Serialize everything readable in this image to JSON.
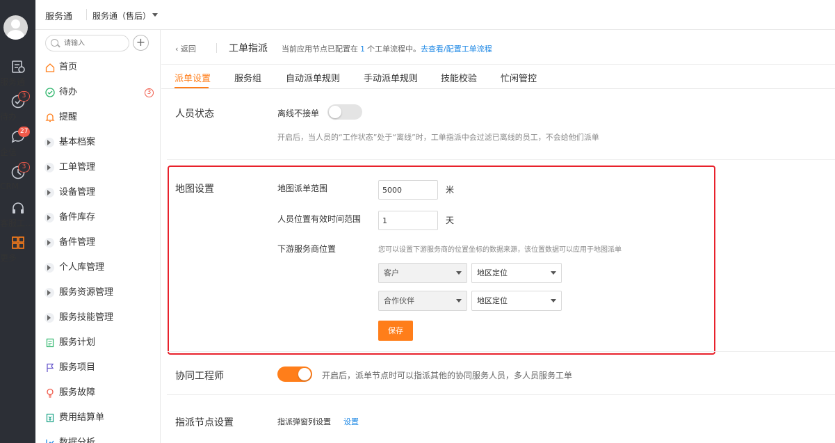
{
  "rail": {
    "items": [
      {
        "label": "服务通",
        "icon": "service-icon",
        "badge": null
      },
      {
        "label": "待办",
        "icon": "todo-check-icon",
        "badge": "3"
      },
      {
        "label": "企信",
        "icon": "chat-bubble-icon",
        "badge": "27"
      },
      {
        "label": "CRM",
        "icon": "crm-clock-icon",
        "badge": "3"
      },
      {
        "label": "客服工…",
        "icon": "headset-icon",
        "badge": null
      },
      {
        "label": "更多",
        "icon": "grid-more-icon",
        "badge": null
      }
    ]
  },
  "topbar": {
    "app_name": "服务通",
    "version_label": "服务通（售后）"
  },
  "sidebar": {
    "search_placeholder": "请输入",
    "add_label": "+",
    "items": [
      {
        "label": "首页",
        "icon": "home-icon"
      },
      {
        "label": "待办",
        "icon": "check-circle-icon",
        "badge": "3"
      },
      {
        "label": "提醒",
        "icon": "bell-icon"
      },
      {
        "label": "基本档案",
        "icon": "expand-arrow-icon"
      },
      {
        "label": "工单管理",
        "icon": "expand-arrow-icon"
      },
      {
        "label": "设备管理",
        "icon": "expand-arrow-icon"
      },
      {
        "label": "备件库存",
        "icon": "expand-arrow-icon"
      },
      {
        "label": "备件管理",
        "icon": "expand-arrow-icon"
      },
      {
        "label": "个人库管理",
        "icon": "expand-arrow-icon"
      },
      {
        "label": "服务资源管理",
        "icon": "expand-arrow-icon"
      },
      {
        "label": "服务技能管理",
        "icon": "expand-arrow-icon"
      },
      {
        "label": "服务计划",
        "icon": "document-icon"
      },
      {
        "label": "服务项目",
        "icon": "flag-icon"
      },
      {
        "label": "服务故障",
        "icon": "bulb-icon"
      },
      {
        "label": "费用结算单",
        "icon": "invoice-icon"
      },
      {
        "label": "数据分析",
        "icon": "chart-icon"
      }
    ]
  },
  "header": {
    "back_label": "返回",
    "page_title": "工单指派",
    "info_prefix": "当前应用节点已配置在",
    "info_count": "1",
    "info_suffix": "个工单流程中。",
    "info_link": "去查看/配置工单流程"
  },
  "tabs": [
    {
      "label": "派单设置",
      "active": true
    },
    {
      "label": "服务组",
      "active": false
    },
    {
      "label": "自动派单规则",
      "active": false
    },
    {
      "label": "手动派单规则",
      "active": false
    },
    {
      "label": "技能校验",
      "active": false
    },
    {
      "label": "忙闲管控",
      "active": false
    }
  ],
  "staff_status": {
    "title": "人员状态",
    "option_label": "离线不接单",
    "enabled": false,
    "hint": "开启后，当人员的“工作状态”处于“离线”时，工单指派中会过滤已离线的员工，不会给他们派单"
  },
  "map_settings": {
    "title": "地图设置",
    "range_label": "地图派单范围",
    "range_value": "5000",
    "range_unit": "米",
    "valid_label": "人员位置有效时间范围",
    "valid_value": "1",
    "valid_unit": "天",
    "downstream_label": "下游服务商位置",
    "downstream_hint": "您可以设置下游服务商的位置坐标的数据来源，该位置数据可以应用于地图派单",
    "rows": [
      {
        "type": "客户",
        "source": "地区定位"
      },
      {
        "type": "合作伙伴",
        "source": "地区定位"
      }
    ],
    "save_label": "保存",
    "highlight_color": "#e8212b"
  },
  "collab": {
    "title": "协同工程师",
    "enabled": true,
    "hint": "开启后，派单节点时可以指派其他的协同服务人员，多人员服务工单"
  },
  "assign_node": {
    "title": "指派节点设置",
    "popup_label": "指派弹窗列设置",
    "setting_link": "设置"
  },
  "colors": {
    "accent": "#ff7e1a",
    "link": "#1e88e5",
    "rail_bg": "#2c2f36"
  }
}
